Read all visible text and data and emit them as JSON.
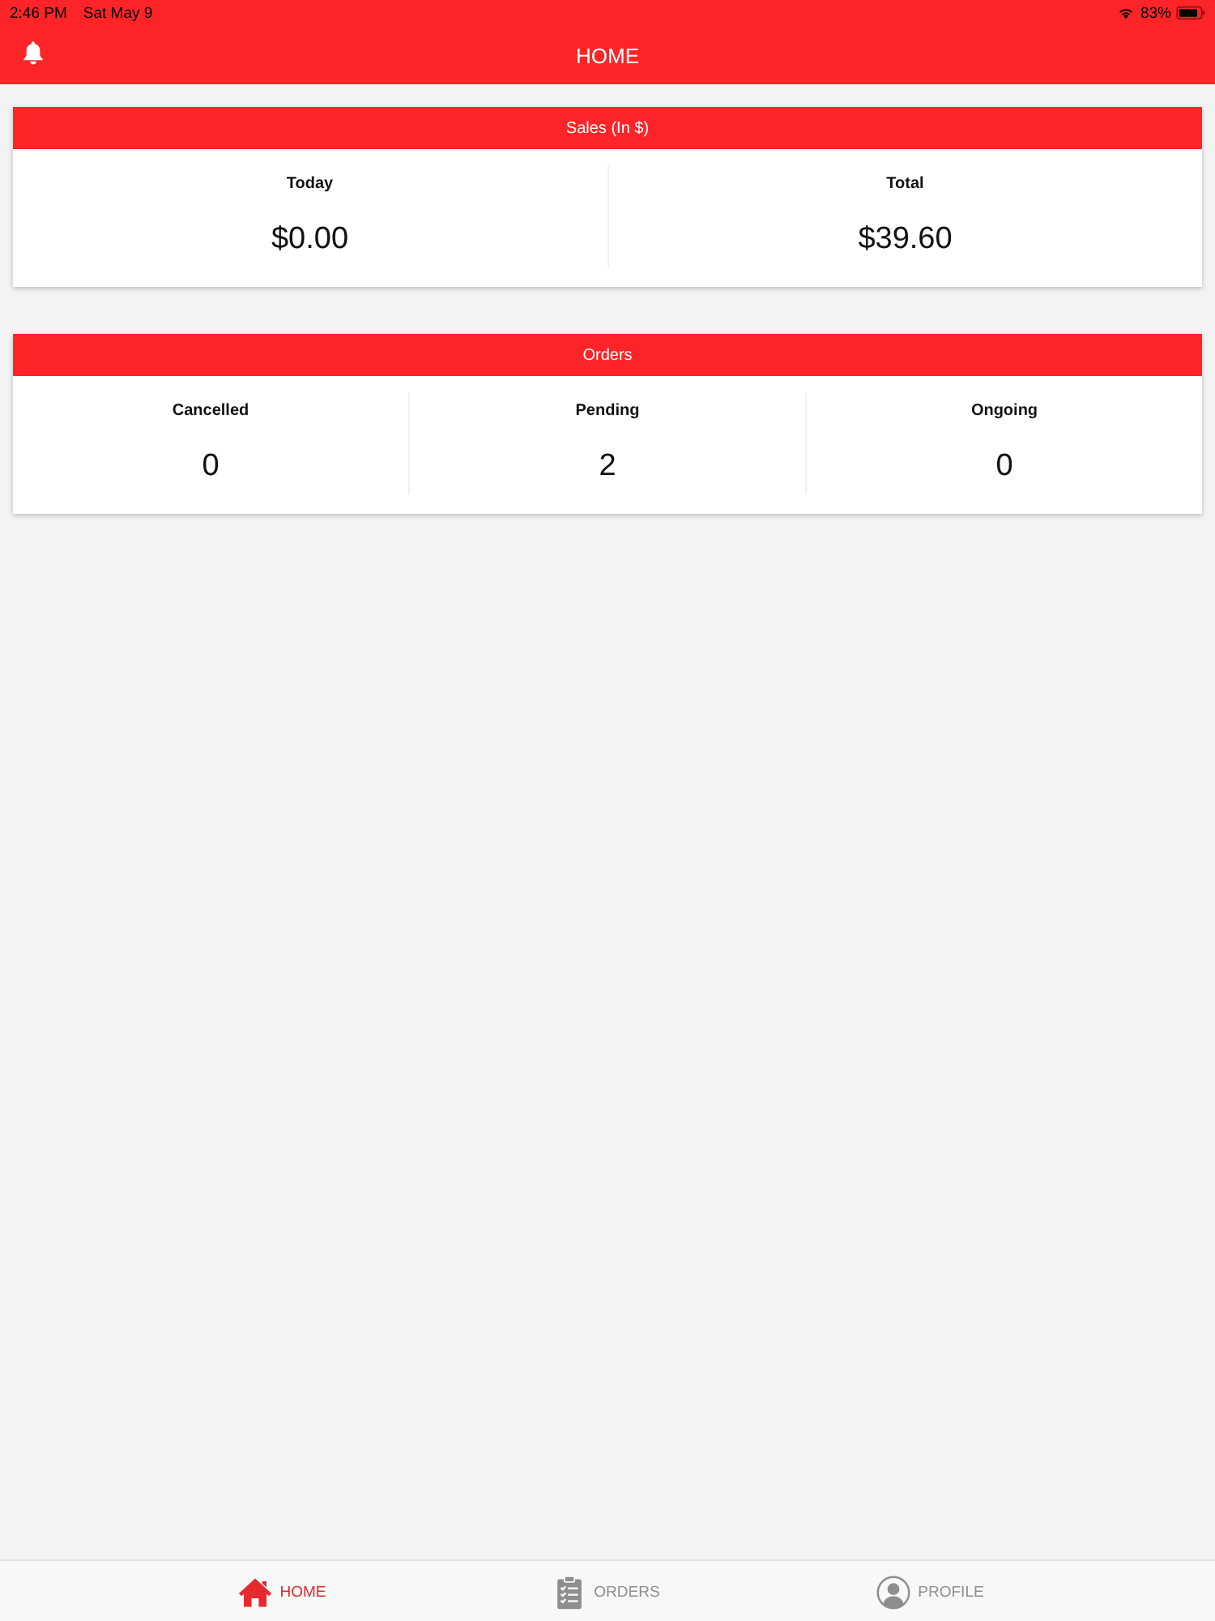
{
  "status_bar": {
    "time": "2:46 PM",
    "date": "Sat May 9",
    "battery": "83%"
  },
  "header": {
    "title": "HOME"
  },
  "cards": [
    {
      "title": "Sales (In $)",
      "stats": [
        {
          "label": "Today",
          "value": "$0.00"
        },
        {
          "label": "Total",
          "value": "$39.60"
        }
      ]
    },
    {
      "title": "Orders",
      "stats": [
        {
          "label": "Cancelled",
          "value": "0"
        },
        {
          "label": "Pending",
          "value": "2"
        },
        {
          "label": "Ongoing",
          "value": "0"
        }
      ]
    }
  ],
  "tab_bar": [
    {
      "label": "HOME",
      "kind": "home",
      "selected": true
    },
    {
      "label": "ORDERS",
      "kind": "orders",
      "selected": false
    },
    {
      "label": "PROFILE",
      "kind": "profile",
      "selected": false
    }
  ]
}
